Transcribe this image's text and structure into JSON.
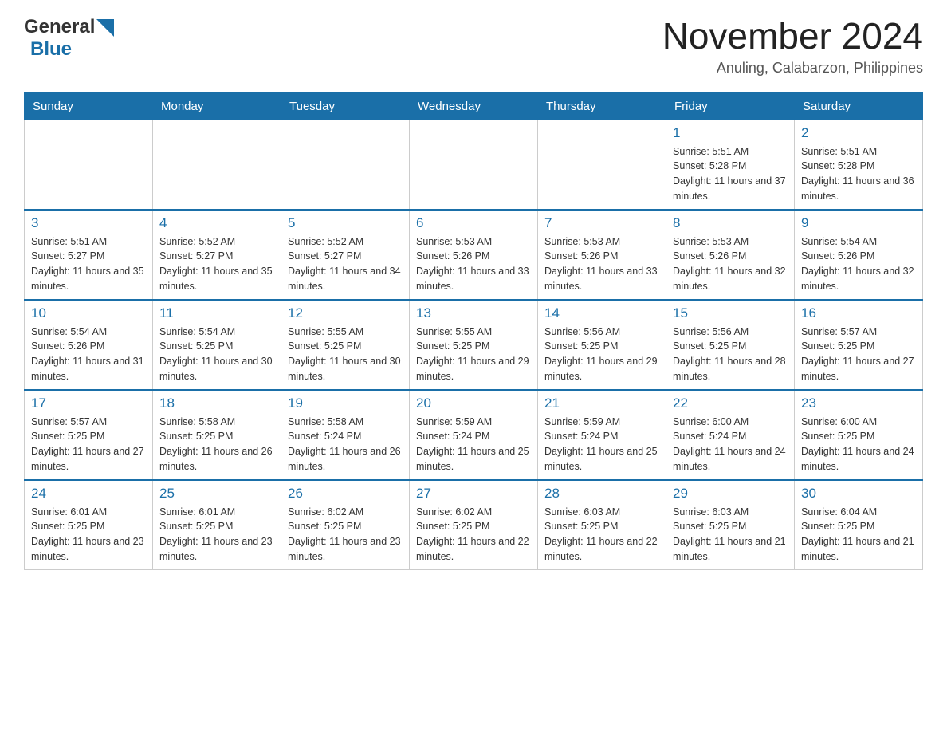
{
  "header": {
    "logo_general": "General",
    "logo_blue": "Blue",
    "month_title": "November 2024",
    "location": "Anuling, Calabarzon, Philippines"
  },
  "weekdays": [
    "Sunday",
    "Monday",
    "Tuesday",
    "Wednesday",
    "Thursday",
    "Friday",
    "Saturday"
  ],
  "weeks": [
    [
      {
        "day": "",
        "sunrise": "",
        "sunset": "",
        "daylight": ""
      },
      {
        "day": "",
        "sunrise": "",
        "sunset": "",
        "daylight": ""
      },
      {
        "day": "",
        "sunrise": "",
        "sunset": "",
        "daylight": ""
      },
      {
        "day": "",
        "sunrise": "",
        "sunset": "",
        "daylight": ""
      },
      {
        "day": "",
        "sunrise": "",
        "sunset": "",
        "daylight": ""
      },
      {
        "day": "1",
        "sunrise": "Sunrise: 5:51 AM",
        "sunset": "Sunset: 5:28 PM",
        "daylight": "Daylight: 11 hours and 37 minutes."
      },
      {
        "day": "2",
        "sunrise": "Sunrise: 5:51 AM",
        "sunset": "Sunset: 5:28 PM",
        "daylight": "Daylight: 11 hours and 36 minutes."
      }
    ],
    [
      {
        "day": "3",
        "sunrise": "Sunrise: 5:51 AM",
        "sunset": "Sunset: 5:27 PM",
        "daylight": "Daylight: 11 hours and 35 minutes."
      },
      {
        "day": "4",
        "sunrise": "Sunrise: 5:52 AM",
        "sunset": "Sunset: 5:27 PM",
        "daylight": "Daylight: 11 hours and 35 minutes."
      },
      {
        "day": "5",
        "sunrise": "Sunrise: 5:52 AM",
        "sunset": "Sunset: 5:27 PM",
        "daylight": "Daylight: 11 hours and 34 minutes."
      },
      {
        "day": "6",
        "sunrise": "Sunrise: 5:53 AM",
        "sunset": "Sunset: 5:26 PM",
        "daylight": "Daylight: 11 hours and 33 minutes."
      },
      {
        "day": "7",
        "sunrise": "Sunrise: 5:53 AM",
        "sunset": "Sunset: 5:26 PM",
        "daylight": "Daylight: 11 hours and 33 minutes."
      },
      {
        "day": "8",
        "sunrise": "Sunrise: 5:53 AM",
        "sunset": "Sunset: 5:26 PM",
        "daylight": "Daylight: 11 hours and 32 minutes."
      },
      {
        "day": "9",
        "sunrise": "Sunrise: 5:54 AM",
        "sunset": "Sunset: 5:26 PM",
        "daylight": "Daylight: 11 hours and 32 minutes."
      }
    ],
    [
      {
        "day": "10",
        "sunrise": "Sunrise: 5:54 AM",
        "sunset": "Sunset: 5:26 PM",
        "daylight": "Daylight: 11 hours and 31 minutes."
      },
      {
        "day": "11",
        "sunrise": "Sunrise: 5:54 AM",
        "sunset": "Sunset: 5:25 PM",
        "daylight": "Daylight: 11 hours and 30 minutes."
      },
      {
        "day": "12",
        "sunrise": "Sunrise: 5:55 AM",
        "sunset": "Sunset: 5:25 PM",
        "daylight": "Daylight: 11 hours and 30 minutes."
      },
      {
        "day": "13",
        "sunrise": "Sunrise: 5:55 AM",
        "sunset": "Sunset: 5:25 PM",
        "daylight": "Daylight: 11 hours and 29 minutes."
      },
      {
        "day": "14",
        "sunrise": "Sunrise: 5:56 AM",
        "sunset": "Sunset: 5:25 PM",
        "daylight": "Daylight: 11 hours and 29 minutes."
      },
      {
        "day": "15",
        "sunrise": "Sunrise: 5:56 AM",
        "sunset": "Sunset: 5:25 PM",
        "daylight": "Daylight: 11 hours and 28 minutes."
      },
      {
        "day": "16",
        "sunrise": "Sunrise: 5:57 AM",
        "sunset": "Sunset: 5:25 PM",
        "daylight": "Daylight: 11 hours and 27 minutes."
      }
    ],
    [
      {
        "day": "17",
        "sunrise": "Sunrise: 5:57 AM",
        "sunset": "Sunset: 5:25 PM",
        "daylight": "Daylight: 11 hours and 27 minutes."
      },
      {
        "day": "18",
        "sunrise": "Sunrise: 5:58 AM",
        "sunset": "Sunset: 5:25 PM",
        "daylight": "Daylight: 11 hours and 26 minutes."
      },
      {
        "day": "19",
        "sunrise": "Sunrise: 5:58 AM",
        "sunset": "Sunset: 5:24 PM",
        "daylight": "Daylight: 11 hours and 26 minutes."
      },
      {
        "day": "20",
        "sunrise": "Sunrise: 5:59 AM",
        "sunset": "Sunset: 5:24 PM",
        "daylight": "Daylight: 11 hours and 25 minutes."
      },
      {
        "day": "21",
        "sunrise": "Sunrise: 5:59 AM",
        "sunset": "Sunset: 5:24 PM",
        "daylight": "Daylight: 11 hours and 25 minutes."
      },
      {
        "day": "22",
        "sunrise": "Sunrise: 6:00 AM",
        "sunset": "Sunset: 5:24 PM",
        "daylight": "Daylight: 11 hours and 24 minutes."
      },
      {
        "day": "23",
        "sunrise": "Sunrise: 6:00 AM",
        "sunset": "Sunset: 5:25 PM",
        "daylight": "Daylight: 11 hours and 24 minutes."
      }
    ],
    [
      {
        "day": "24",
        "sunrise": "Sunrise: 6:01 AM",
        "sunset": "Sunset: 5:25 PM",
        "daylight": "Daylight: 11 hours and 23 minutes."
      },
      {
        "day": "25",
        "sunrise": "Sunrise: 6:01 AM",
        "sunset": "Sunset: 5:25 PM",
        "daylight": "Daylight: 11 hours and 23 minutes."
      },
      {
        "day": "26",
        "sunrise": "Sunrise: 6:02 AM",
        "sunset": "Sunset: 5:25 PM",
        "daylight": "Daylight: 11 hours and 23 minutes."
      },
      {
        "day": "27",
        "sunrise": "Sunrise: 6:02 AM",
        "sunset": "Sunset: 5:25 PM",
        "daylight": "Daylight: 11 hours and 22 minutes."
      },
      {
        "day": "28",
        "sunrise": "Sunrise: 6:03 AM",
        "sunset": "Sunset: 5:25 PM",
        "daylight": "Daylight: 11 hours and 22 minutes."
      },
      {
        "day": "29",
        "sunrise": "Sunrise: 6:03 AM",
        "sunset": "Sunset: 5:25 PM",
        "daylight": "Daylight: 11 hours and 21 minutes."
      },
      {
        "day": "30",
        "sunrise": "Sunrise: 6:04 AM",
        "sunset": "Sunset: 5:25 PM",
        "daylight": "Daylight: 11 hours and 21 minutes."
      }
    ]
  ]
}
